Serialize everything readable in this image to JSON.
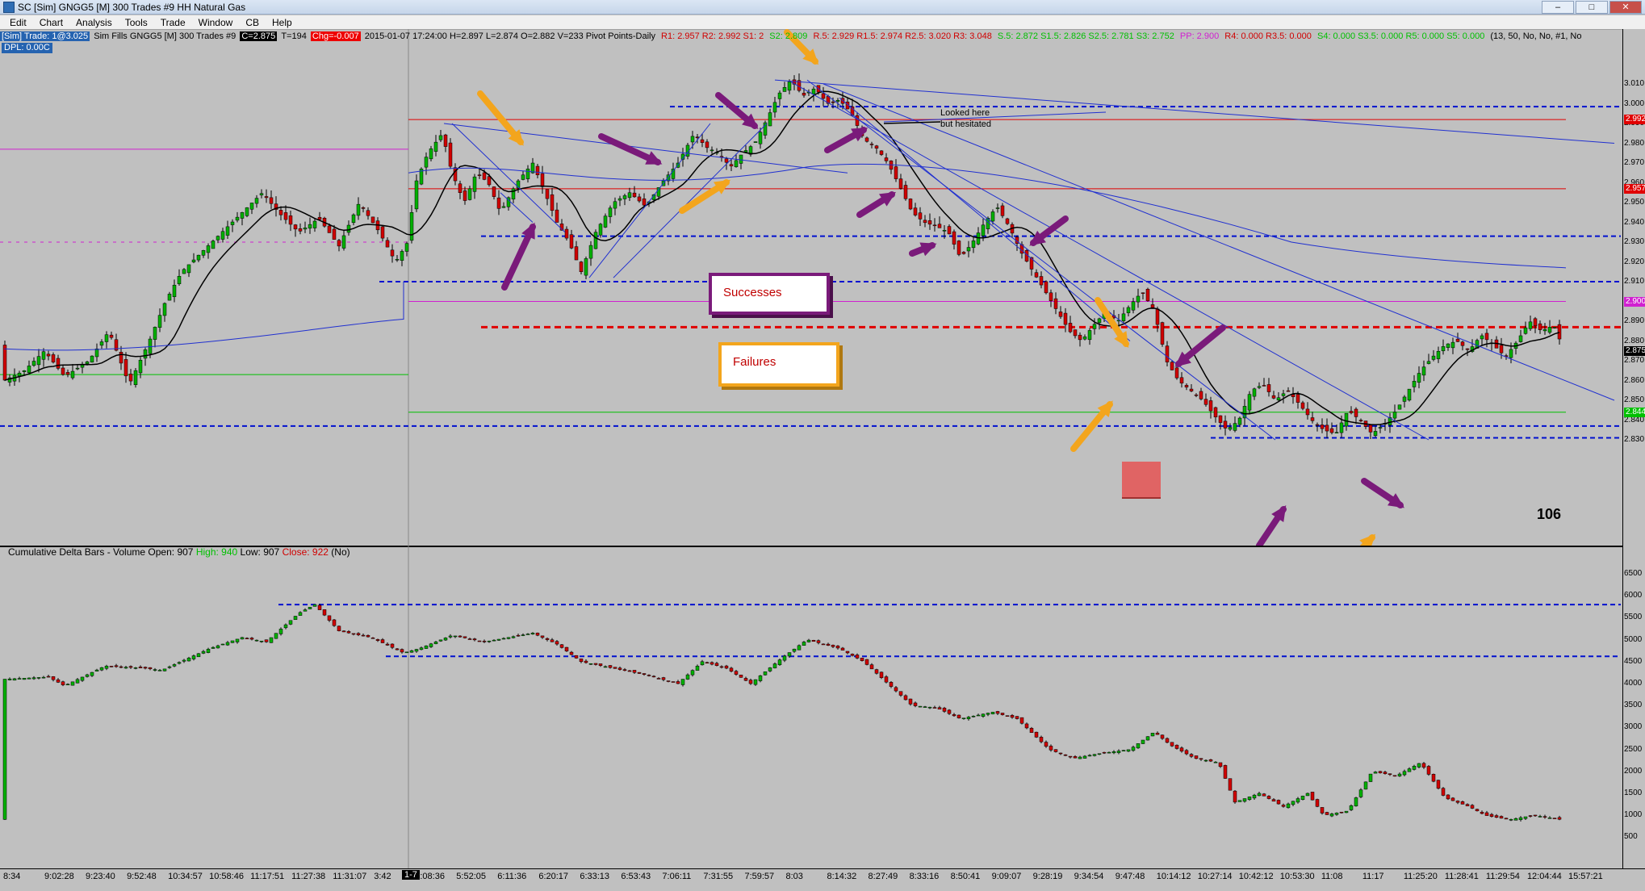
{
  "title_bar": {
    "title": "SC [Sim] GNGG5 [M]  300 Trades  #9  HH Natural Gas",
    "controls": [
      "–",
      "□",
      "✕"
    ]
  },
  "menu": {
    "items": [
      "Edit",
      "Chart",
      "Analysis",
      "Tools",
      "Trade",
      "Window",
      "CB",
      "Help"
    ]
  },
  "info_bar": {
    "sim_trade": "[Sim]  Trade: 1@3.025",
    "sim_fills": "Sim Fills  GNGG5 [M]  300 Trades  #9",
    "close_value": "C=2.875",
    "t_value": "T=194",
    "change": "Chg=-0.007",
    "ohlc": "2015-01-07 17:24:00  H=2.897  L=2.874  O=2.882  V=233  Pivot Points-Daily",
    "pivots_red": "R1: 2.957   R2: 2.992   S1: 2",
    "pivots_green": "S2: 2.809",
    "pivots_red2": "R.5: 2.929   R1.5: 2.974   R2.5: 3.020   R3: 3.048",
    "pivots_green2": "S.5: 2.872   S1.5: 2.826   S2.5: 2.781   S3: 2.752",
    "pp": "PP: 2.900",
    "r4": "R4: 0.000   R3.5: 0.000",
    "s": "S4: 0.000   S3.5: 0.000   R5: 0.000   S5: 0.000",
    "params": "(13, 50, No, No, #1, No"
  },
  "dpl": "DPL: 0.00C",
  "annotations": {
    "successes_label": "Successes",
    "failures_label": "Failures",
    "note": "Looked here\nbut hesitated",
    "count": "106"
  },
  "lower_panel": {
    "name": "Cumulative Delta Bars - Volume",
    "open": "Open: 907",
    "high": "High: 940",
    "low": "Low: 907",
    "close": "Close: 922",
    "flag": "(No)"
  },
  "price_axis": {
    "ticks": [
      "3.010",
      "3.000",
      "2.990",
      "2.980",
      "2.970",
      "2.960",
      "2.950",
      "2.940",
      "2.930",
      "2.920",
      "2.910",
      "2.900",
      "2.890",
      "2.880",
      "2.870",
      "2.860",
      "2.850",
      "2.840",
      "2.830"
    ],
    "badges": [
      {
        "label": "2.992",
        "color": "#e00000"
      },
      {
        "label": "2.957",
        "color": "#e00000"
      },
      {
        "label": "2.900",
        "color": "#d020d0"
      },
      {
        "label": "2.875",
        "color": "#000000"
      },
      {
        "label": "2.844",
        "color": "#00c000"
      }
    ]
  },
  "volume_axis": {
    "ticks": [
      "6500",
      "6000",
      "5500",
      "5000",
      "4500",
      "4000",
      "3500",
      "3000",
      "2500",
      "2000",
      "1500",
      "1000",
      "500"
    ]
  },
  "time_axis": {
    "session_tag": "1-7",
    "labels": [
      "8:34",
      "9:02:28",
      "9:23:40",
      "9:52:48",
      "10:34:57",
      "10:58:46",
      "11:17:51",
      "11:27:38",
      "11:31:07",
      "3:42",
      "5:08:36",
      "5:52:05",
      "6:11:36",
      "6:20:17",
      "6:33:13",
      "6:53:43",
      "7:06:11",
      "7:31:55",
      "7:59:57",
      "8:03",
      "8:14:32",
      "8:27:49",
      "8:33:16",
      "8:50:41",
      "9:09:07",
      "9:28:19",
      "9:34:54",
      "9:47:48",
      "10:14:12",
      "10:27:14",
      "10:42:12",
      "10:53:30",
      "11:08",
      "11:17",
      "11:25:20",
      "11:28:41",
      "11:29:54",
      "12:04:44",
      "15:57:21"
    ]
  },
  "colors": {
    "bg": "#c0c0c0",
    "up_bar": "#00b000",
    "down_bar": "#d00000",
    "ma": "#000000",
    "vwap": "#2030d0",
    "level_blue": "#0010d0",
    "pivot_red": "#e00000",
    "pivot_green": "#00c000",
    "pp_pink": "#d020d0",
    "arrow_orange": "#f3a51d",
    "arrow_purple": "#7a1a7a"
  }
}
